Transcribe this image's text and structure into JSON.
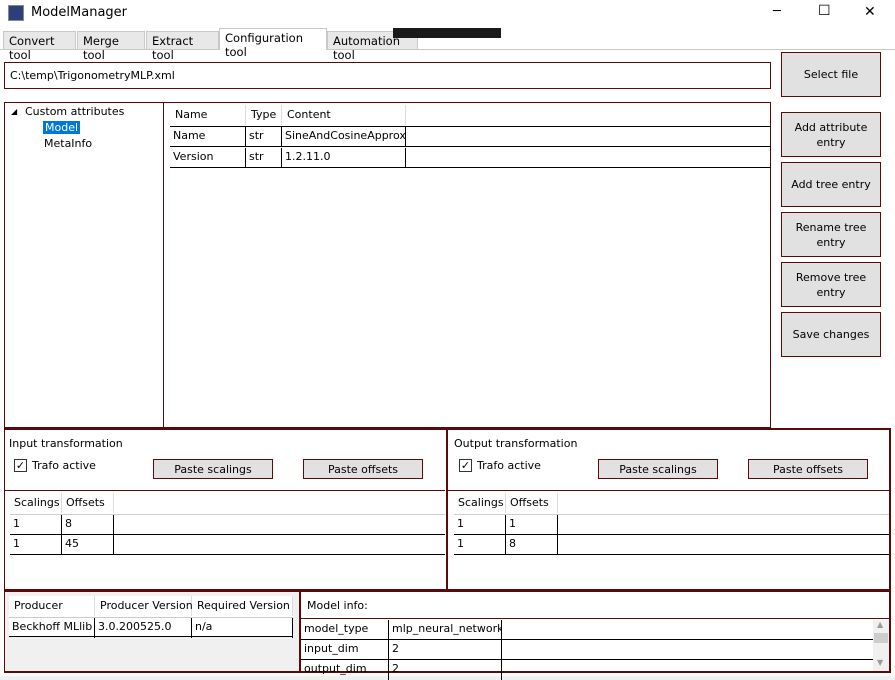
{
  "window": {
    "title": "ModelManager",
    "minimize": "─",
    "maximize": "☐",
    "close": "✕"
  },
  "tabs": [
    {
      "label": "Convert tool"
    },
    {
      "label": "Merge tool"
    },
    {
      "label": "Extract tool"
    },
    {
      "label": "Configuration tool"
    },
    {
      "label": "Automation tool"
    }
  ],
  "file": {
    "path": "C:\\temp\\TrigonometryMLP.xml",
    "select_label": "Select file"
  },
  "tree": {
    "root": "Custom attributes",
    "children": [
      "Model",
      "MetaInfo"
    ],
    "selected": "Model"
  },
  "attributes": {
    "columns": [
      "Name",
      "Type",
      "Content"
    ],
    "rows": [
      [
        "Name",
        "str",
        "SineAndCosineApprox"
      ],
      [
        "Version",
        "str",
        "1.2.11.0"
      ]
    ]
  },
  "actions": [
    "Add attribute entry",
    "Add tree entry",
    "Rename tree entry",
    "Remove tree entry",
    "Save changes"
  ],
  "input_trafo": {
    "title": "Input transformation",
    "active_label": "Trafo active",
    "active": true,
    "paste_scalings": "Paste scalings",
    "paste_offsets": "Paste offsets",
    "columns": [
      "Scalings",
      "Offsets"
    ],
    "rows": [
      [
        "1",
        "8"
      ],
      [
        "1",
        "45"
      ]
    ]
  },
  "output_trafo": {
    "title": "Output transformation",
    "active_label": "Trafo active",
    "active": true,
    "paste_scalings": "Paste scalings",
    "paste_offsets": "Paste offsets",
    "columns": [
      "Scalings",
      "Offsets"
    ],
    "rows": [
      [
        "1",
        "1"
      ],
      [
        "1",
        "8"
      ]
    ]
  },
  "producer": {
    "columns": [
      "Producer",
      "Producer Version",
      "Required Version"
    ],
    "rows": [
      [
        "Beckhoff MLlib",
        "3.0.200525.0",
        "n/a"
      ]
    ]
  },
  "model_info": {
    "title": "Model info:",
    "rows": [
      [
        "model_type",
        "mlp_neural_network"
      ],
      [
        "input_dim",
        "2"
      ],
      [
        "output_dim",
        "2"
      ]
    ]
  }
}
